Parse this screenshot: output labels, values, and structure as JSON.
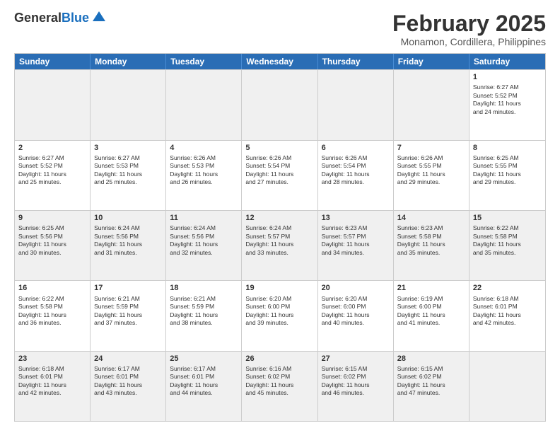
{
  "header": {
    "logo_general": "General",
    "logo_blue": "Blue",
    "month_year": "February 2025",
    "location": "Monamon, Cordillera, Philippines"
  },
  "weekdays": [
    "Sunday",
    "Monday",
    "Tuesday",
    "Wednesday",
    "Thursday",
    "Friday",
    "Saturday"
  ],
  "weeks": [
    [
      {
        "day": "",
        "info": "",
        "shaded": true
      },
      {
        "day": "",
        "info": "",
        "shaded": true
      },
      {
        "day": "",
        "info": "",
        "shaded": true
      },
      {
        "day": "",
        "info": "",
        "shaded": true
      },
      {
        "day": "",
        "info": "",
        "shaded": true
      },
      {
        "day": "",
        "info": "",
        "shaded": true
      },
      {
        "day": "1",
        "info": "Sunrise: 6:27 AM\nSunset: 5:52 PM\nDaylight: 11 hours\nand 24 minutes."
      }
    ],
    [
      {
        "day": "2",
        "info": "Sunrise: 6:27 AM\nSunset: 5:52 PM\nDaylight: 11 hours\nand 25 minutes."
      },
      {
        "day": "3",
        "info": "Sunrise: 6:27 AM\nSunset: 5:53 PM\nDaylight: 11 hours\nand 25 minutes."
      },
      {
        "day": "4",
        "info": "Sunrise: 6:26 AM\nSunset: 5:53 PM\nDaylight: 11 hours\nand 26 minutes."
      },
      {
        "day": "5",
        "info": "Sunrise: 6:26 AM\nSunset: 5:54 PM\nDaylight: 11 hours\nand 27 minutes."
      },
      {
        "day": "6",
        "info": "Sunrise: 6:26 AM\nSunset: 5:54 PM\nDaylight: 11 hours\nand 28 minutes."
      },
      {
        "day": "7",
        "info": "Sunrise: 6:26 AM\nSunset: 5:55 PM\nDaylight: 11 hours\nand 29 minutes."
      },
      {
        "day": "8",
        "info": "Sunrise: 6:25 AM\nSunset: 5:55 PM\nDaylight: 11 hours\nand 29 minutes."
      }
    ],
    [
      {
        "day": "9",
        "info": "Sunrise: 6:25 AM\nSunset: 5:56 PM\nDaylight: 11 hours\nand 30 minutes.",
        "shaded": true
      },
      {
        "day": "10",
        "info": "Sunrise: 6:24 AM\nSunset: 5:56 PM\nDaylight: 11 hours\nand 31 minutes.",
        "shaded": true
      },
      {
        "day": "11",
        "info": "Sunrise: 6:24 AM\nSunset: 5:56 PM\nDaylight: 11 hours\nand 32 minutes.",
        "shaded": true
      },
      {
        "day": "12",
        "info": "Sunrise: 6:24 AM\nSunset: 5:57 PM\nDaylight: 11 hours\nand 33 minutes.",
        "shaded": true
      },
      {
        "day": "13",
        "info": "Sunrise: 6:23 AM\nSunset: 5:57 PM\nDaylight: 11 hours\nand 34 minutes.",
        "shaded": true
      },
      {
        "day": "14",
        "info": "Sunrise: 6:23 AM\nSunset: 5:58 PM\nDaylight: 11 hours\nand 35 minutes.",
        "shaded": true
      },
      {
        "day": "15",
        "info": "Sunrise: 6:22 AM\nSunset: 5:58 PM\nDaylight: 11 hours\nand 35 minutes.",
        "shaded": true
      }
    ],
    [
      {
        "day": "16",
        "info": "Sunrise: 6:22 AM\nSunset: 5:58 PM\nDaylight: 11 hours\nand 36 minutes."
      },
      {
        "day": "17",
        "info": "Sunrise: 6:21 AM\nSunset: 5:59 PM\nDaylight: 11 hours\nand 37 minutes."
      },
      {
        "day": "18",
        "info": "Sunrise: 6:21 AM\nSunset: 5:59 PM\nDaylight: 11 hours\nand 38 minutes."
      },
      {
        "day": "19",
        "info": "Sunrise: 6:20 AM\nSunset: 6:00 PM\nDaylight: 11 hours\nand 39 minutes."
      },
      {
        "day": "20",
        "info": "Sunrise: 6:20 AM\nSunset: 6:00 PM\nDaylight: 11 hours\nand 40 minutes."
      },
      {
        "day": "21",
        "info": "Sunrise: 6:19 AM\nSunset: 6:00 PM\nDaylight: 11 hours\nand 41 minutes."
      },
      {
        "day": "22",
        "info": "Sunrise: 6:18 AM\nSunset: 6:01 PM\nDaylight: 11 hours\nand 42 minutes."
      }
    ],
    [
      {
        "day": "23",
        "info": "Sunrise: 6:18 AM\nSunset: 6:01 PM\nDaylight: 11 hours\nand 42 minutes.",
        "shaded": true
      },
      {
        "day": "24",
        "info": "Sunrise: 6:17 AM\nSunset: 6:01 PM\nDaylight: 11 hours\nand 43 minutes.",
        "shaded": true
      },
      {
        "day": "25",
        "info": "Sunrise: 6:17 AM\nSunset: 6:01 PM\nDaylight: 11 hours\nand 44 minutes.",
        "shaded": true
      },
      {
        "day": "26",
        "info": "Sunrise: 6:16 AM\nSunset: 6:02 PM\nDaylight: 11 hours\nand 45 minutes.",
        "shaded": true
      },
      {
        "day": "27",
        "info": "Sunrise: 6:15 AM\nSunset: 6:02 PM\nDaylight: 11 hours\nand 46 minutes.",
        "shaded": true
      },
      {
        "day": "28",
        "info": "Sunrise: 6:15 AM\nSunset: 6:02 PM\nDaylight: 11 hours\nand 47 minutes.",
        "shaded": true
      },
      {
        "day": "",
        "info": "",
        "shaded": true
      }
    ]
  ]
}
